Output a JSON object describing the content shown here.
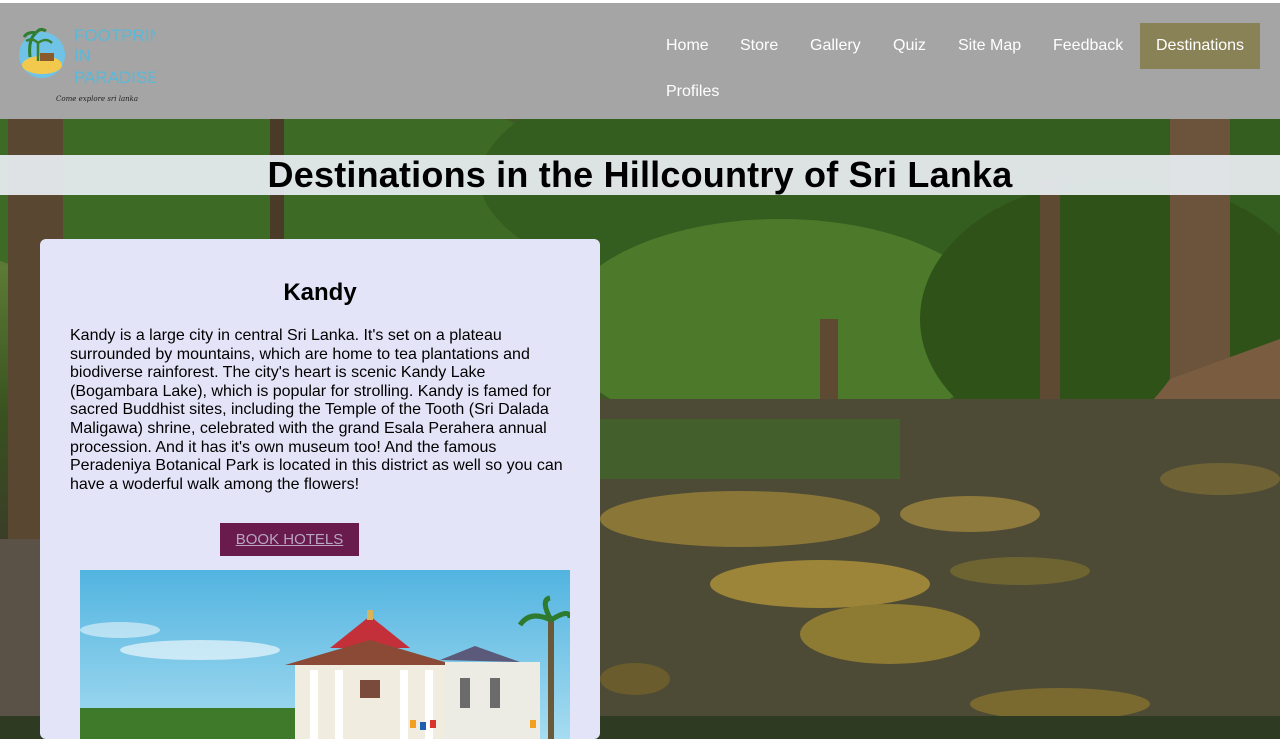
{
  "brand": {
    "logo_name": "Footprints in Paradise",
    "tagline": "Come explore sri lanka"
  },
  "nav": {
    "items": [
      {
        "label": "Home"
      },
      {
        "label": "Store"
      },
      {
        "label": "Gallery"
      },
      {
        "label": "Quiz"
      },
      {
        "label": "Site Map"
      },
      {
        "label": "Feedback"
      },
      {
        "label": "Destinations",
        "active": true
      },
      {
        "label": "Profiles"
      }
    ]
  },
  "page": {
    "title": "Destinations in the Hillcountry of Sri Lanka"
  },
  "destination": {
    "name": "Kandy",
    "description": "Kandy is a large city in central Sri Lanka. It's set on a plateau surrounded by mountains, which are home to tea plantations and biodiverse rainforest. The city's heart is scenic Kandy Lake (Bogambara Lake), which is popular for strolling. Kandy is famed for sacred Buddhist sites, including the Temple of the Tooth (Sri Dalada Maligawa) shrine, celebrated with the grand Esala Perahera annual procession. And it has it's own museum too! And the famous Peradeniya Botanical Park is located in this district as well so you can have a woderful walk among the flowers!",
    "book_button": "BOOK HOTELS"
  },
  "colors": {
    "navbar": "#a5a5a5",
    "nav_active": "#8a8257",
    "card_bg": "#e4e4f8",
    "book_button_bg": "#681b4c"
  }
}
